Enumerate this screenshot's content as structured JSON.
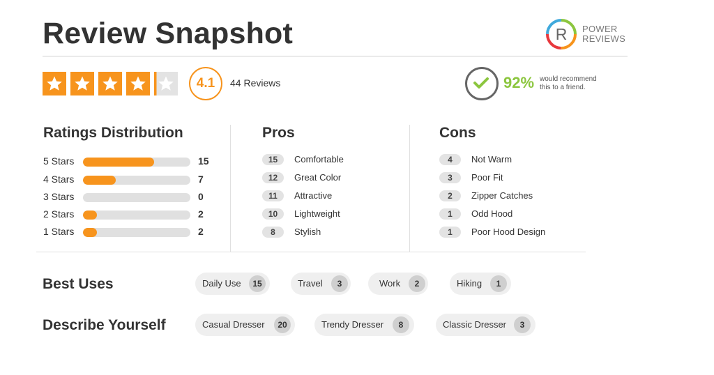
{
  "header": {
    "title": "Review Snapshot"
  },
  "logo": {
    "line1": "POWER",
    "line2": "REVIEWS",
    "letter": "R"
  },
  "summary": {
    "stars": {
      "value": 4.1,
      "max": 5
    },
    "rating": "4.1",
    "review_count": "44 Reviews",
    "recommend_pct": "92%",
    "recommend_text": "would recommend this to a friend."
  },
  "distribution": {
    "title": "Ratings Distribution",
    "max": 15,
    "rows": [
      {
        "label": "5 Stars",
        "count": "15",
        "value": 15
      },
      {
        "label": "4 Stars",
        "count": "7",
        "value": 7
      },
      {
        "label": "3 Stars",
        "count": "0",
        "value": 0
      },
      {
        "label": "2 Stars",
        "count": "2",
        "value": 2
      },
      {
        "label": "1 Stars",
        "count": "2",
        "value": 2
      }
    ]
  },
  "pros": {
    "title": "Pros",
    "items": [
      {
        "count": "15",
        "label": "Comfortable"
      },
      {
        "count": "12",
        "label": "Great Color"
      },
      {
        "count": "11",
        "label": "Attractive"
      },
      {
        "count": "10",
        "label": "Lightweight"
      },
      {
        "count": "8",
        "label": "Stylish"
      }
    ]
  },
  "cons": {
    "title": "Cons",
    "items": [
      {
        "count": "4",
        "label": "Not Warm"
      },
      {
        "count": "3",
        "label": "Poor Fit"
      },
      {
        "count": "2",
        "label": "Zipper Catches"
      },
      {
        "count": "1",
        "label": "Odd Hood"
      },
      {
        "count": "1",
        "label": "Poor Hood Design"
      }
    ]
  },
  "best_uses": {
    "title": "Best Uses",
    "items": [
      {
        "label": "Daily Use",
        "count": "15"
      },
      {
        "label": "Travel",
        "count": "3"
      },
      {
        "label": "Work",
        "count": "2"
      },
      {
        "label": "Hiking",
        "count": "1"
      }
    ]
  },
  "describe": {
    "title": "Describe Yourself",
    "items": [
      {
        "label": "Casual Dresser",
        "count": "20"
      },
      {
        "label": "Trendy Dresser",
        "count": "8"
      },
      {
        "label": "Classic Dresser",
        "count": "3"
      }
    ]
  },
  "colors": {
    "accent": "#f7941d",
    "recommend": "#8cc63f",
    "track": "#e0e0e0"
  }
}
